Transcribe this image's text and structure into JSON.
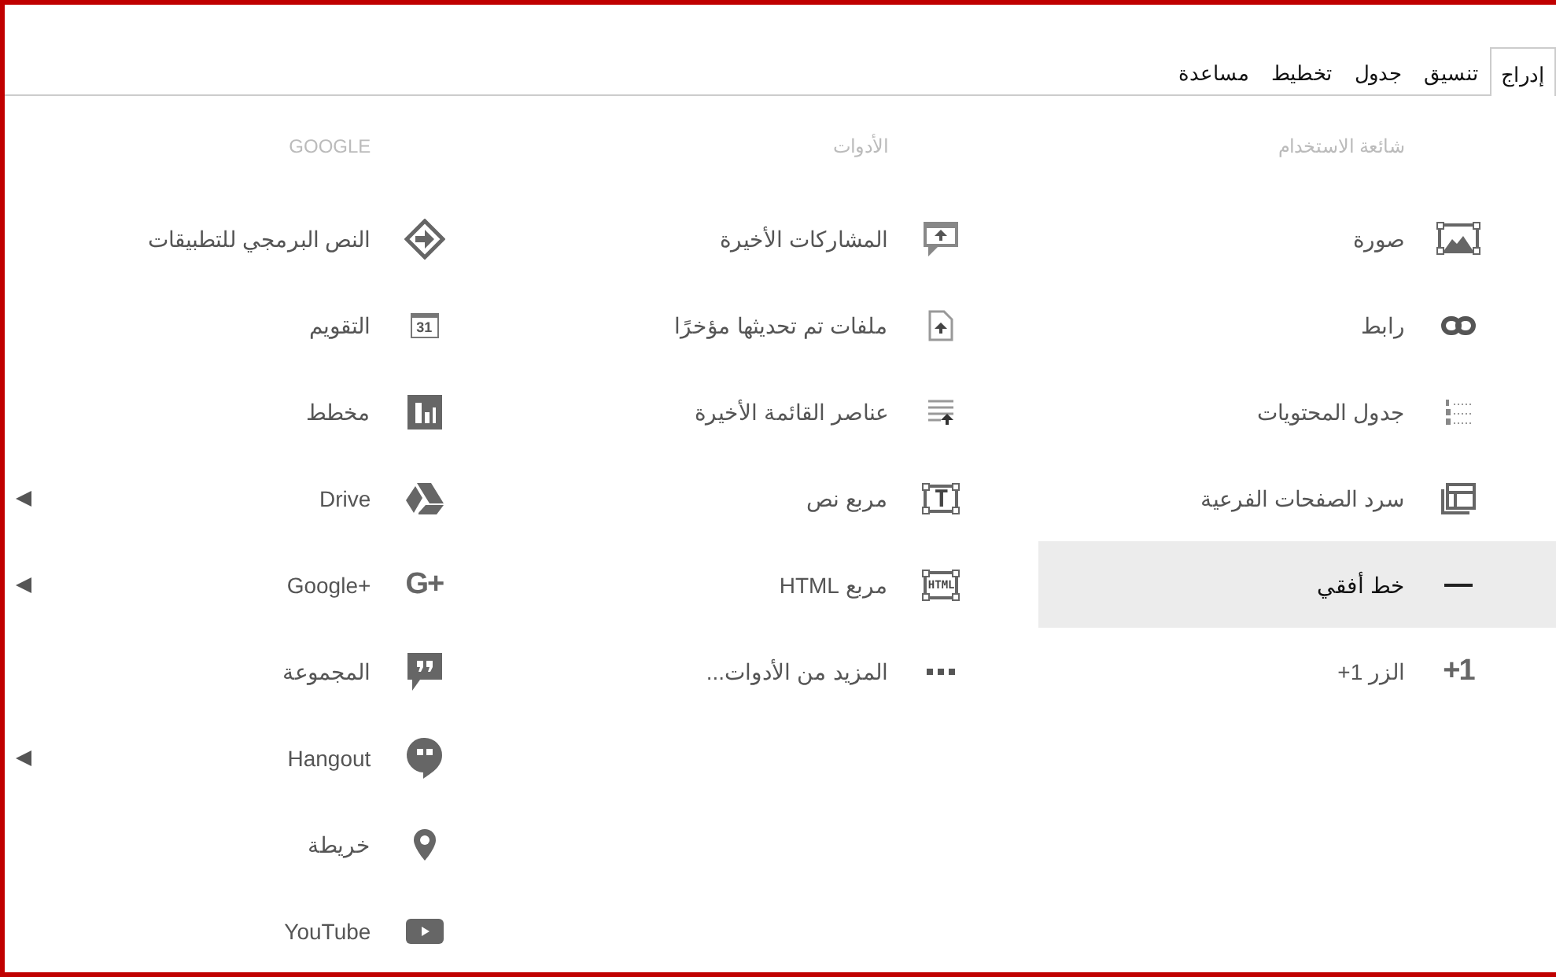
{
  "tabs": [
    {
      "label": "إدراج",
      "selected": true
    },
    {
      "label": "تنسيق",
      "selected": false
    },
    {
      "label": "جدول",
      "selected": false
    },
    {
      "label": "تخطيط",
      "selected": false
    },
    {
      "label": "مساعدة",
      "selected": false
    }
  ],
  "columns": [
    {
      "heading": "شائعة الاستخدام",
      "items": [
        {
          "label": "صورة",
          "highlighted": false,
          "has_submenu": false
        },
        {
          "label": "رابط",
          "highlighted": false,
          "has_submenu": false
        },
        {
          "label": "جدول المحتويات",
          "highlighted": false,
          "has_submenu": false
        },
        {
          "label": "سرد الصفحات الفرعية",
          "highlighted": false,
          "has_submenu": false
        },
        {
          "label": "خط أفقي",
          "highlighted": true,
          "has_submenu": false
        },
        {
          "label": "الزر 1+",
          "icon_text": "+1",
          "highlighted": false,
          "has_submenu": false
        }
      ]
    },
    {
      "heading": "الأدوات",
      "items": [
        {
          "label": "المشاركات الأخيرة",
          "highlighted": false,
          "has_submenu": false
        },
        {
          "label": "ملفات تم تحديثها مؤخرًا",
          "highlighted": false,
          "has_submenu": false
        },
        {
          "label": "عناصر القائمة الأخيرة",
          "highlighted": false,
          "has_submenu": false
        },
        {
          "label": "مربع نص",
          "icon_text": "T",
          "highlighted": false,
          "has_submenu": false
        },
        {
          "label": "مربع HTML",
          "icon_text": "HTML",
          "highlighted": false,
          "has_submenu": false
        },
        {
          "label": "المزيد من الأدوات...",
          "highlighted": false,
          "has_submenu": false
        }
      ]
    },
    {
      "heading": "GOOGLE",
      "items": [
        {
          "label": "النص البرمجي للتطبيقات",
          "highlighted": false,
          "has_submenu": false
        },
        {
          "label": "التقويم",
          "icon_text": "31",
          "highlighted": false,
          "has_submenu": false
        },
        {
          "label": "مخطط",
          "highlighted": false,
          "has_submenu": false
        },
        {
          "label": "Drive",
          "highlighted": false,
          "has_submenu": true
        },
        {
          "label": "Google+",
          "icon_text": "G+",
          "highlighted": false,
          "has_submenu": true
        },
        {
          "label": "المجموعة",
          "highlighted": false,
          "has_submenu": false
        },
        {
          "label": "Hangout",
          "highlighted": false,
          "has_submenu": true
        },
        {
          "label": "خريطة",
          "highlighted": false,
          "has_submenu": false
        },
        {
          "label": "YouTube",
          "highlighted": false,
          "has_submenu": false
        }
      ]
    }
  ]
}
